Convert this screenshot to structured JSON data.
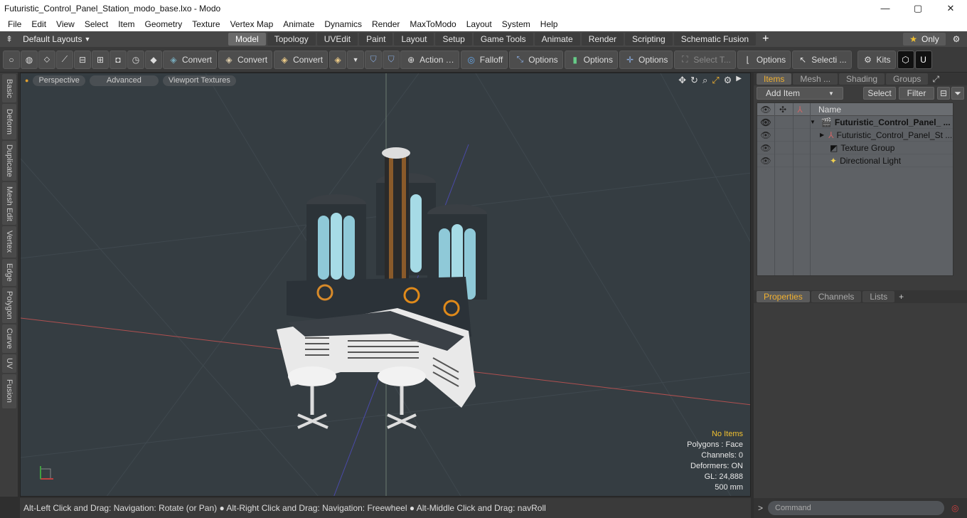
{
  "window": {
    "title": "Futuristic_Control_Panel_Station_modo_base.lxo - Modo",
    "minimize": "—",
    "maximize": "▢",
    "close": "✕"
  },
  "menu": [
    "File",
    "Edit",
    "View",
    "Select",
    "Item",
    "Geometry",
    "Texture",
    "Vertex Map",
    "Animate",
    "Dynamics",
    "Render",
    "MaxToModo",
    "Layout",
    "System",
    "Help"
  ],
  "tabs": {
    "layouts_label": "Default Layouts",
    "items": [
      "Model",
      "Topology",
      "UVEdit",
      "Paint",
      "Layout",
      "Setup",
      "Game Tools",
      "Animate",
      "Render",
      "Scripting",
      "Schematic Fusion"
    ],
    "active": "Model",
    "only_label": "Only"
  },
  "toolbar": {
    "convert1": "Convert",
    "convert2": "Convert",
    "convert3": "Convert",
    "action": "Action",
    "falloff": "Falloff",
    "options1": "Options",
    "options2": "Options",
    "options3": "Options",
    "options4": "Options",
    "select_t": "Select T...",
    "selecti": "Selecti ...",
    "kits": "Kits"
  },
  "left_tabs": [
    "Basic",
    "Deform",
    "Duplicate",
    "Mesh Edit",
    "Vertex",
    "Edge",
    "Polygon",
    "Curve",
    "UV",
    "Fusion"
  ],
  "viewport": {
    "buttons": [
      "Perspective",
      "Advanced",
      "Viewport Textures"
    ],
    "info": {
      "no_items": "No Items",
      "polygons": "Polygons : Face",
      "channels": "Channels: 0",
      "deformers": "Deformers: ON",
      "gl": "GL: 24,888",
      "scale": "500 mm"
    }
  },
  "status": "Alt-Left Click and Drag: Navigation: Rotate (or Pan) ● Alt-Right Click and Drag: Navigation: Freewheel ● Alt-Middle Click and Drag: navRoll",
  "right": {
    "tabs": [
      "Items",
      "Mesh ...",
      "Shading",
      "Groups"
    ],
    "add_item": "Add Item",
    "select": "Select",
    "filter": "Filter",
    "name_col": "Name",
    "items": [
      {
        "label": "Futuristic_Control_Panel_ ..."
      },
      {
        "label": "Futuristic_Control_Panel_St ..."
      },
      {
        "label": "Texture Group"
      },
      {
        "label": "Directional Light"
      }
    ],
    "prop_tabs": [
      "Properties",
      "Channels",
      "Lists"
    ],
    "command_placeholder": "Command"
  }
}
